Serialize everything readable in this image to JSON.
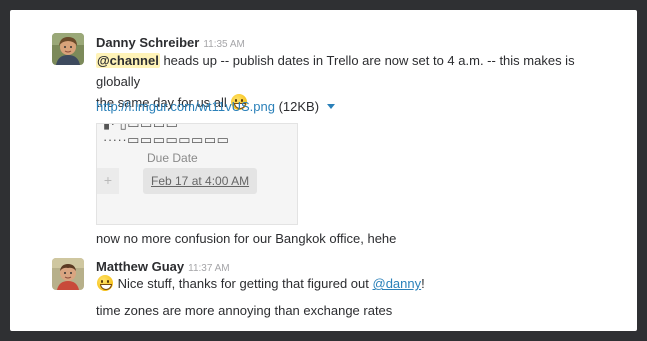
{
  "messages": [
    {
      "author": "Danny Schreiber",
      "time": "11:35 AM",
      "text_mention": "@channel",
      "text_line1": "heads up -- publish dates in Trello are now set to 4 a.m. -- this makes is globally",
      "text_line2": "the same day for us all",
      "emoji": "smile-emoji",
      "attachment": {
        "link": "http://i.imgur.com/wt11vUS.png",
        "size": "(12KB)",
        "preview": {
          "label": "Due Date",
          "date_button": "Feb 17 at 4:00 AM",
          "plus": "+"
        }
      },
      "followup": "now no more confusion for our Bangkok office, hehe"
    },
    {
      "author": "Matthew Guay",
      "time": "11:37 AM",
      "emoji": "smile-emoji",
      "text_before": "Nice stuff, thanks for getting that figured out",
      "mention": "@danny",
      "text_after": "!",
      "followup": "time zones are more annoying than exchange rates"
    }
  ],
  "colors": {
    "mention_highlight": "#fff3b8",
    "link": "#2a80b9",
    "timestamp": "#a5a5a8"
  }
}
